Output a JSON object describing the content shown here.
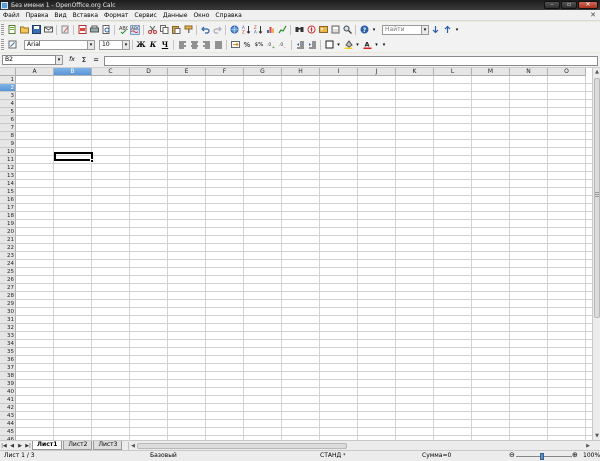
{
  "window": {
    "title": "Без имени 1 - OpenOffice.org Calc",
    "buttons": {
      "minimize": "–",
      "maximize": "▫",
      "close": "✕"
    }
  },
  "menu": {
    "items": [
      "Файл",
      "Правка",
      "Вид",
      "Вставка",
      "Формат",
      "Сервис",
      "Данные",
      "Окно",
      "Справка"
    ],
    "close_document": "✕"
  },
  "standard_toolbar": {
    "find_placeholder": "Найти"
  },
  "formatting_toolbar": {
    "font_name": "Arial",
    "font_size": "10",
    "bold": "Ж",
    "italic": "К",
    "underline": "Ч",
    "percent": "%",
    "currency": "$%"
  },
  "formula_bar": {
    "name_box": "B2",
    "fx_icon": "fx",
    "sum_icon": "Σ",
    "equals_icon": "="
  },
  "grid": {
    "columns": [
      "A",
      "B",
      "C",
      "D",
      "E",
      "F",
      "G",
      "H",
      "I",
      "J",
      "K",
      "L",
      "M",
      "N",
      "O"
    ],
    "rows": [
      "1",
      "2",
      "3",
      "4",
      "5",
      "6",
      "7",
      "8",
      "9",
      "10",
      "11",
      "12",
      "13",
      "14",
      "15",
      "16",
      "17",
      "18",
      "19",
      "20",
      "21",
      "22",
      "23",
      "24",
      "25",
      "26",
      "27",
      "28",
      "29",
      "30",
      "31",
      "32",
      "33",
      "34",
      "35",
      "36",
      "37",
      "38",
      "39",
      "40",
      "41",
      "42",
      "43",
      "44",
      "45",
      "46"
    ],
    "selected_column": "B",
    "selected_row": "2"
  },
  "sheets": {
    "tabs": [
      "Лист1",
      "Лист2",
      "Лист3"
    ],
    "active": "Лист1"
  },
  "status": {
    "sheet_position": "Лист 1 / 3",
    "page_style": "Базовый",
    "mode": "СТАНД",
    "sum": "Сумма=0",
    "zoom": "100%"
  }
}
